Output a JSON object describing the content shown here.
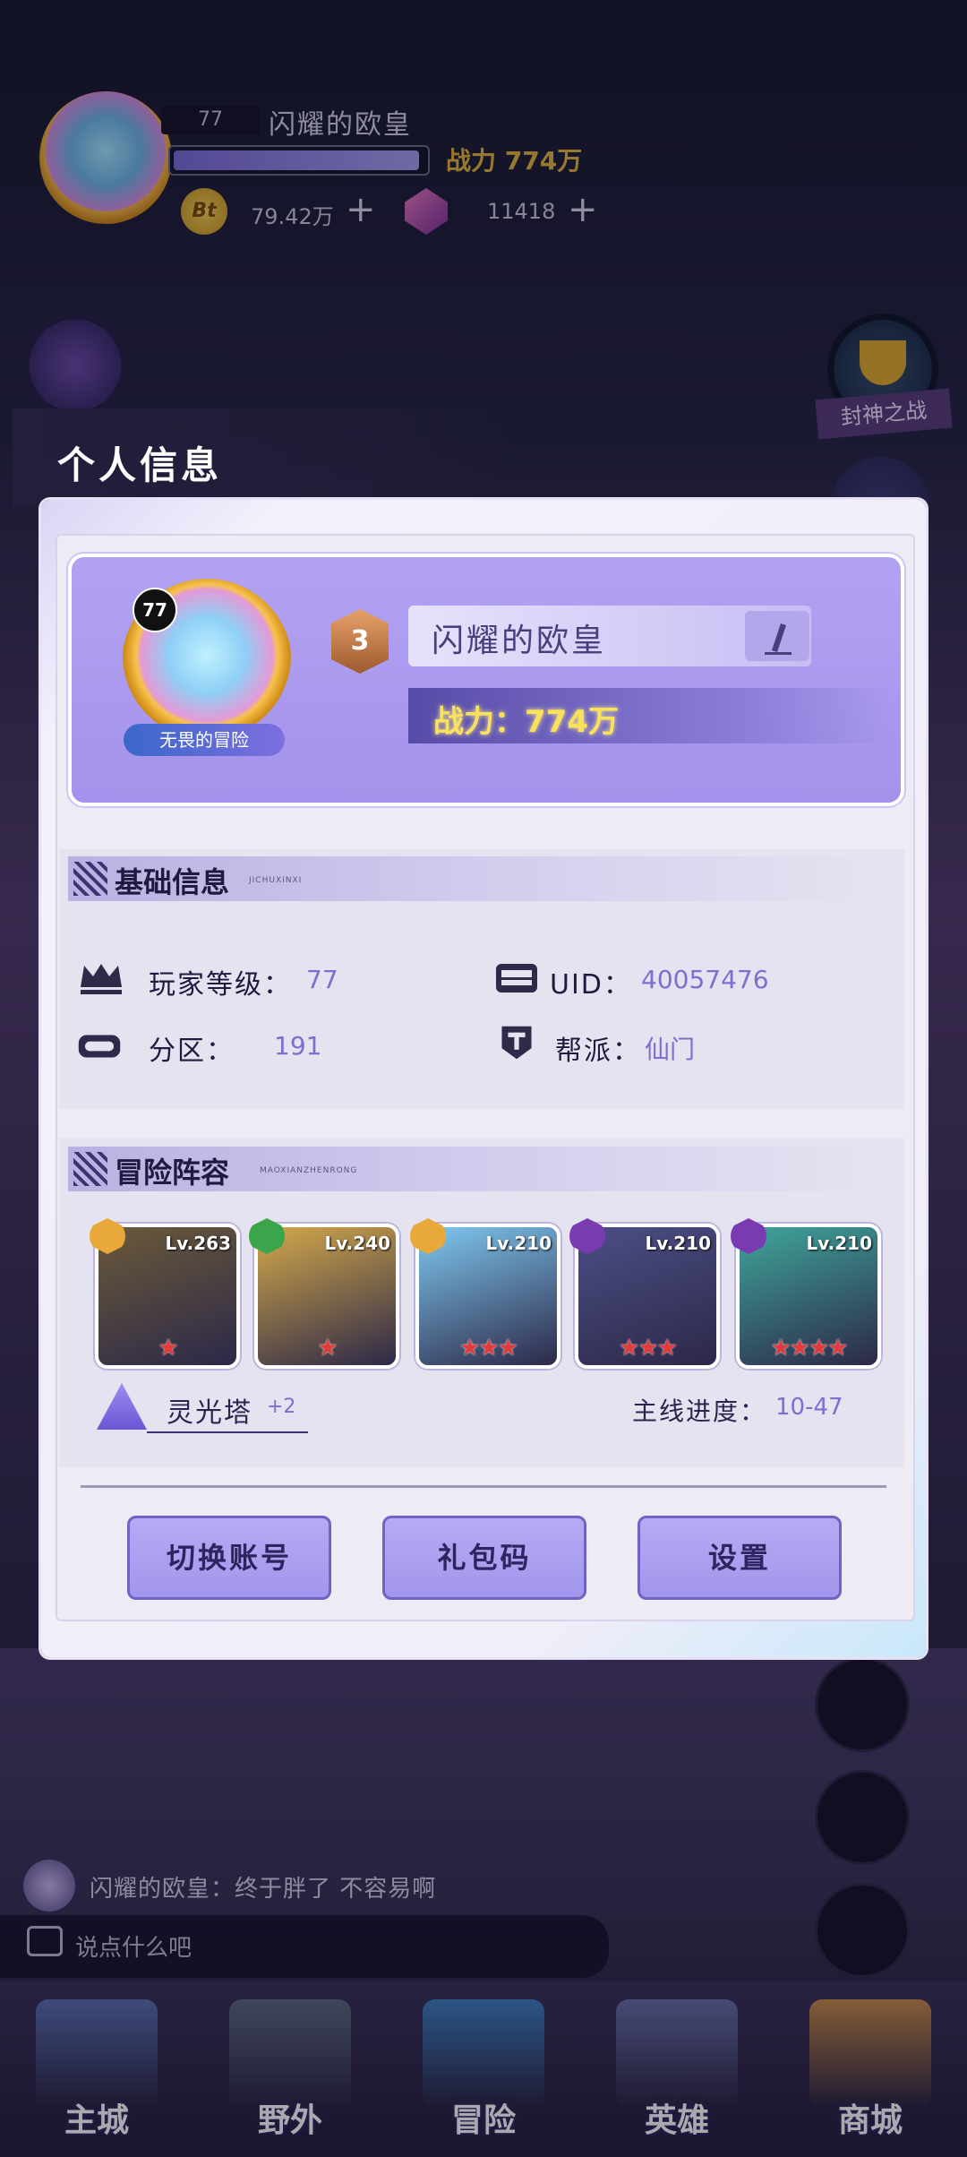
{
  "hud": {
    "level": "77",
    "player_name": "闪耀的欧皇",
    "exp_progress": 0.98,
    "power": "战力 774万",
    "coin_icon_text": "Bt",
    "coins": "79.42万",
    "gems": "11418",
    "plus": "+",
    "avatar_caption": "无畏的冒险",
    "event_label": "封神之战"
  },
  "modal": {
    "title": "个人信息",
    "profile": {
      "avatar_level": "77",
      "avatar_title": "无畏的冒险",
      "rank": "3",
      "name": "闪耀的欧皇",
      "power": "战力：774万"
    },
    "basic": {
      "section_title": "基础信息",
      "section_sub": "JICHUXINXI",
      "player_level_label": "玩家等级：",
      "player_level_value": "77",
      "uid_label": "UID：",
      "uid_value": "40057476",
      "zone_label": "分区：",
      "zone_value": "191",
      "guild_label": "帮派：",
      "guild_value": "仙门"
    },
    "team": {
      "section_title": "冒险阵容",
      "section_sub": "MAOXIANZHENRONG",
      "heroes": [
        {
          "level": "Lv.263",
          "element": "sun",
          "color": "#e8a93a",
          "stars": "★",
          "bg": "#6b5a3a"
        },
        {
          "level": "Lv.240",
          "element": "leaf",
          "color": "#3aa54a",
          "stars": "★",
          "bg": "#d4a94a"
        },
        {
          "level": "Lv.210",
          "element": "sun",
          "color": "#e8a93a",
          "stars": "★★★",
          "bg": "#7fc8f0"
        },
        {
          "level": "Lv.210",
          "element": "void",
          "color": "#7a3ab0",
          "stars": "★★★",
          "bg": "#4c4f86"
        },
        {
          "level": "Lv.210",
          "element": "void",
          "color": "#7a3ab0",
          "stars": "★★★★",
          "bg": "#3fa59b"
        }
      ],
      "tower_label": "灵光塔",
      "tower_bonus": "+2",
      "progress_label": "主线进度：",
      "progress_value": "10-47"
    },
    "buttons": {
      "switch_account": "切换账号",
      "gift_code": "礼包码",
      "settings": "设置"
    }
  },
  "chat": {
    "sender": "闪耀的欧皇：",
    "message": "终于胖了 不容易啊",
    "placeholder": "说点什么吧"
  },
  "nav": {
    "items": [
      {
        "label": "主城",
        "color": "#5b6fb0"
      },
      {
        "label": "野外",
        "color": "#5e6a80"
      },
      {
        "label": "冒险",
        "color": "#3f7fc0"
      },
      {
        "label": "英雄",
        "color": "#6a6fa8"
      },
      {
        "label": "商城",
        "color": "#c88a4a"
      }
    ]
  }
}
